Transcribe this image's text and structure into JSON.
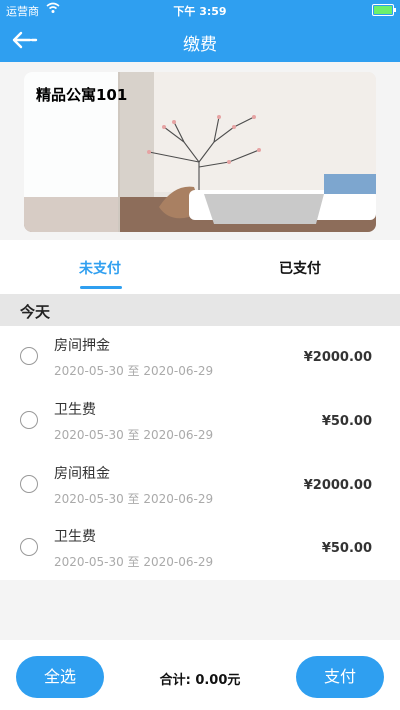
{
  "status_bar": {
    "carrier": "运营商",
    "time": "下午 3:59"
  },
  "nav": {
    "title": "缴费",
    "back_icon": "back-arrow-icon"
  },
  "banner": {
    "title": "精品公寓101"
  },
  "tabs": [
    {
      "label": "未支付",
      "active": true
    },
    {
      "label": "已支付",
      "active": false
    }
  ],
  "section": {
    "label": "今天"
  },
  "items": [
    {
      "name": "房间押金",
      "date_range": "2020-05-30 至 2020-06-29",
      "amount": "¥2000.00",
      "checked": false
    },
    {
      "name": "卫生费",
      "date_range": "2020-05-30 至 2020-06-29",
      "amount": "¥50.00",
      "checked": false
    },
    {
      "name": "房间租金",
      "date_range": "2020-05-30 至 2020-06-29",
      "amount": "¥2000.00",
      "checked": false
    },
    {
      "name": "卫生费",
      "date_range": "2020-05-30 至 2020-06-29",
      "amount": "¥50.00",
      "checked": false
    }
  ],
  "footer": {
    "select_all_label": "全选",
    "total_label": "合计: 0.00元",
    "pay_label": "支付"
  },
  "colors": {
    "primary": "#2f9ff0",
    "section_bg": "#e6e6e6",
    "page_bg": "#f4f4f4"
  }
}
